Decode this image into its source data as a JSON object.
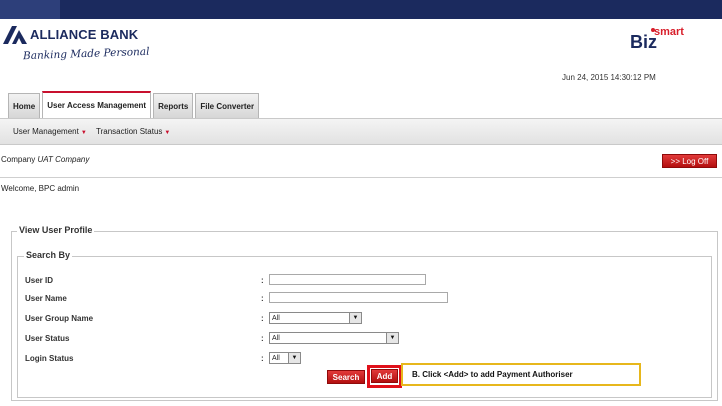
{
  "brand": {
    "bank_name": "ALLIANCE BANK",
    "tagline": "Banking Made Personal",
    "product_main": "Biz",
    "product_super": "smart"
  },
  "header": {
    "datetime": "Jun 24, 2015 14:30:12 PM"
  },
  "tabs": [
    {
      "label": "Home",
      "active": false
    },
    {
      "label": "User Access Management",
      "active": true
    },
    {
      "label": "Reports",
      "active": false
    },
    {
      "label": "File Converter",
      "active": false
    }
  ],
  "submenu": [
    {
      "label": "User Management"
    },
    {
      "label": "Transaction Status"
    }
  ],
  "session": {
    "company_label": "Company",
    "company_name": "UAT Company",
    "welcome": "Welcome, BPC admin",
    "logoff_label": ">> Log Off"
  },
  "view_panel": {
    "title": "View User Profile",
    "search_title": "Search By",
    "fields": {
      "user_id": {
        "label": "User ID",
        "value": ""
      },
      "user_name": {
        "label": "User Name",
        "value": ""
      },
      "user_group_name": {
        "label": "User Group Name",
        "value": "All"
      },
      "user_status": {
        "label": "User Status",
        "value": "All"
      },
      "login_status": {
        "label": "Login Status",
        "value": "All"
      }
    },
    "colon": ":",
    "search_button": "Search",
    "add_button": "Add"
  },
  "annotation": {
    "text": "B.    Click <Add> to add Payment Authoriser",
    "border_color": "#e7b71c",
    "highlight_color": "#e0101a"
  },
  "colors": {
    "brand_navy": "#1b2a5e",
    "accent_red": "#c8102e"
  }
}
